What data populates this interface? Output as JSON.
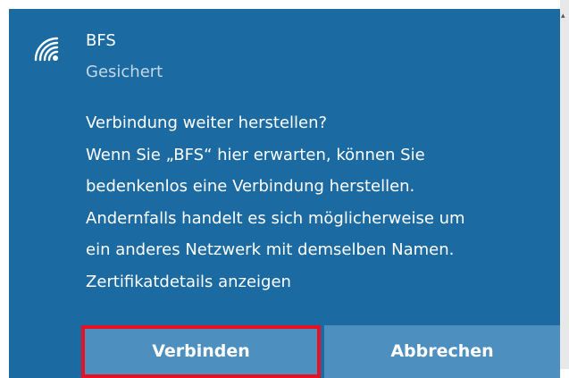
{
  "network": {
    "icon": "wifi-secured-icon",
    "name": "BFS",
    "status": "Gesichert"
  },
  "message": {
    "lines": [
      "Verbindung weiter herstellen?",
      "Wenn Sie „BFS“ hier erwarten, können Sie",
      "bedenkenlos eine Verbindung herstellen.",
      "Andernfalls handelt es sich möglicherweise um",
      "ein anderes Netzwerk mit demselben Namen."
    ],
    "cert_link": "Zertifikatdetails anzeigen"
  },
  "buttons": {
    "connect": "Verbinden",
    "cancel": "Abbrechen"
  },
  "colors": {
    "panel": "#1b6aa2",
    "button": "#4d8fbf",
    "highlight": "#e81123"
  }
}
